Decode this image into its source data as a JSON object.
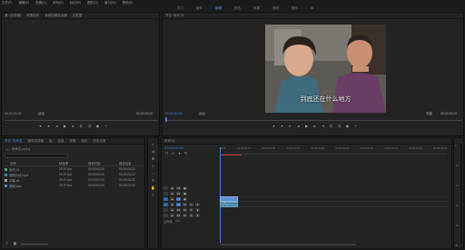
{
  "menu": [
    "文件(F)",
    "编辑(E)",
    "剪辑(C)",
    "序列(S)",
    "标记(M)",
    "图形(G)",
    "窗口(W)",
    "帮助(H)"
  ],
  "workspaces": [
    "学习",
    "组件",
    "编辑",
    "颜色",
    "效果",
    "音频",
    "图形",
    "库"
  ],
  "active_workspace": "编辑",
  "source": {
    "tabs": [
      "源: (无剪辑)",
      "效果控件",
      "音频剪辑混合器",
      "元数据"
    ],
    "timecode_left": "00;00;00;00",
    "fit": "适合",
    "timecode_right": "00;00;00;00"
  },
  "program": {
    "tab": "节目: 序列 01",
    "timecode_left": "00;00;00;00",
    "fit": "适合",
    "full": "完整",
    "timecode_right": "00;00;04;22",
    "subtitle": "到底还在什么地方"
  },
  "project": {
    "tabs": [
      "项目: 未命名",
      "媒体浏览器",
      "库",
      "信息",
      "效果",
      "标记",
      "历史记录"
    ],
    "file": "未命名.prproj",
    "search_placeholder": "",
    "columns": [
      "名称",
      "帧速率",
      "媒体开始",
      "媒体结束"
    ],
    "items": [
      {
        "name": "序列 01",
        "fps": "29.97 fps",
        "start": "00;00;00;00",
        "end": "00;00;04;22",
        "color": "#4fae6a"
      },
      {
        "name": "视频片段.mp4",
        "fps": "29.97 fps",
        "start": "00;00;00;00",
        "end": "00;00;04;22",
        "color": "#4a7fd0"
      },
      {
        "name": "字幕.srt",
        "fps": "29.97 fps",
        "start": "00;00;00;00",
        "end": "00;00;04;22",
        "color": "#a0a0a0"
      },
      {
        "name": "音频.wav",
        "fps": "29.97 fps",
        "start": "00;00;00;00",
        "end": "00;00;04;22",
        "color": "#4a7fd0"
      }
    ]
  },
  "timeline": {
    "tab": "序列 01",
    "timecode": "00;00;00;00",
    "ruler": [
      "00;00",
      "00;00;00;15",
      "00;00;01;00",
      "00;00;01;15",
      "00;00;02;00",
      "00;00;02;15",
      "00;00;03;00",
      "00;00;03;15",
      "00;00;04;00",
      "00;00;04;15"
    ],
    "tracks": [
      "V3",
      "V2",
      "V1",
      "A1",
      "A2",
      "A3"
    ],
    "master": "主声道",
    "master_value": "0.0",
    "db_scale": [
      "0",
      "-12",
      "-24",
      "-36",
      "-48",
      "dB"
    ]
  }
}
